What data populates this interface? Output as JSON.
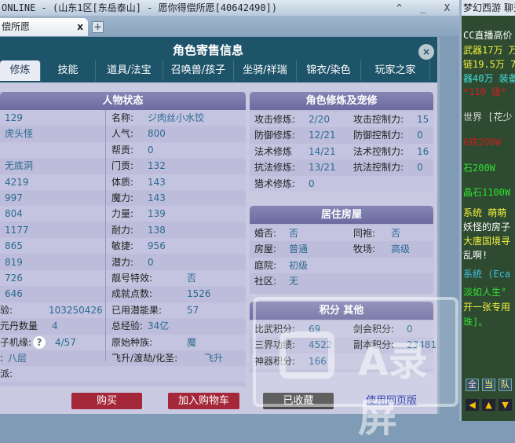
{
  "window": {
    "title": "ONLINE - (山东1区[东岳泰山] - 愿你得偿所愿[40642490])",
    "controls": "^ _ X"
  },
  "tab": {
    "label": "偿所愿",
    "close": "x",
    "add": "+"
  },
  "dialog": {
    "title": "角色寄售信息",
    "close": "×",
    "tabs": [
      "修炼",
      "技能",
      "道具/法宝",
      "召唤兽/孩子",
      "坐骑/祥瑞",
      "锦衣/染色",
      "玩家之家"
    ]
  },
  "status": {
    "title": "人物状态",
    "left": [
      "129",
      "虎头怪",
      "",
      "无底洞",
      "4219",
      "997",
      "804",
      "1177",
      "865",
      "819",
      "726",
      "646"
    ],
    "left_extra": [
      {
        "label": "验:",
        "value": "103250426"
      },
      {
        "label": "元丹数量",
        "value": "4"
      },
      {
        "label": "子机缘:",
        "value": "4/57",
        "help": "?"
      },
      {
        "label": ":",
        "value": "八层"
      },
      {
        "label": "派:",
        "value": ""
      }
    ],
    "mid": [
      {
        "label": "名称:",
        "value": "ジ肉丝小水饺"
      },
      {
        "label": "人气:",
        "value": "800"
      },
      {
        "label": "帮贡:",
        "value": "0"
      },
      {
        "label": "门贡:",
        "value": "132"
      },
      {
        "label": "体质:",
        "value": "143"
      },
      {
        "label": "魔力:",
        "value": "143"
      },
      {
        "label": "力量:",
        "value": "139"
      },
      {
        "label": "耐力:",
        "value": "138"
      },
      {
        "label": "敏捷:",
        "value": "956"
      },
      {
        "label": "潜力:",
        "value": "0"
      },
      {
        "label": "靓号特效:",
        "value": "否"
      },
      {
        "label": "成就点数:",
        "value": "1526"
      },
      {
        "label": "已用潜能果:",
        "value": "57"
      },
      {
        "label": "总经验:",
        "value": "34亿"
      },
      {
        "label": "原始种族:",
        "value": "魔"
      },
      {
        "label": "飞升/渡劫/化圣:",
        "value": "飞升"
      }
    ]
  },
  "cultivation": {
    "title": "角色修炼及宠修",
    "rows": [
      [
        "攻击修炼:",
        "2/20",
        "攻击控制力:",
        "15"
      ],
      [
        "防御修炼:",
        "12/21",
        "防御控制力:",
        "0"
      ],
      [
        "法术修炼",
        "14/21",
        "法术控制力:",
        "16"
      ],
      [
        "抗法修炼:",
        "13/21",
        "抗法控制力:",
        "0"
      ],
      [
        "猎术修炼:",
        "0",
        "",
        ""
      ]
    ]
  },
  "house": {
    "title": "居住房屋",
    "rows": [
      [
        "婚否:",
        "否",
        "同袍:",
        "否"
      ],
      [
        "房屋:",
        "普通",
        "牧场:",
        "高级"
      ],
      [
        "庭院:",
        "初级",
        "",
        ""
      ],
      [
        "社区:",
        "无",
        "",
        ""
      ]
    ]
  },
  "points": {
    "title": "积分 其他",
    "rows": [
      [
        "比武积分:",
        "69",
        "剑会积分:",
        "0"
      ],
      [
        "三界功绩:",
        "4522",
        "副本积分:",
        "23481"
      ],
      [
        "神器积分:",
        "166",
        "",
        ""
      ]
    ]
  },
  "buttons": {
    "buy": "购买",
    "cart": "加入购物车",
    "saved": "已收藏",
    "web": "使用网页版"
  },
  "chat": {
    "title": "梦幻西游 聊天",
    "lines": [
      {
        "t": "CC直播高价",
        "c": "#fff"
      },
      {
        "t": "武器17万 万",
        "c": "#f0f040"
      },
      {
        "t": "链19.5万 7",
        "c": "#f0f040"
      },
      {
        "t": "器40万 装备",
        "c": "#40e0e0"
      },
      {
        "t": "*110 级*",
        "c": "#d02020"
      },
      {
        "t": "世界 [花少",
        "c": "#ddd"
      },
      {
        "t": "6铁200W",
        "c": "#c02020"
      },
      {
        "t": "石200W",
        "c": "#30e030"
      },
      {
        "t": "晶石1100W",
        "c": "#30e030"
      },
      {
        "t": "系统 萌萌",
        "c": "#f0f040"
      },
      {
        "t": "妖怪的房子",
        "c": "#fff"
      },
      {
        "t": "大唐国境寻",
        "c": "#f0f040"
      },
      {
        "t": "乱啊!",
        "c": "#fff"
      },
      {
        "t": "系统 (Eca",
        "c": "#40c0e0"
      },
      {
        "t": "淡如人生°",
        "c": "#30e030"
      },
      {
        "t": "开一张专用",
        "c": "#f0f040"
      },
      {
        "t": "珠]。",
        "c": "#30e030"
      }
    ],
    "channels": [
      "全",
      "当",
      "队"
    ]
  },
  "watermark": "A录屏"
}
